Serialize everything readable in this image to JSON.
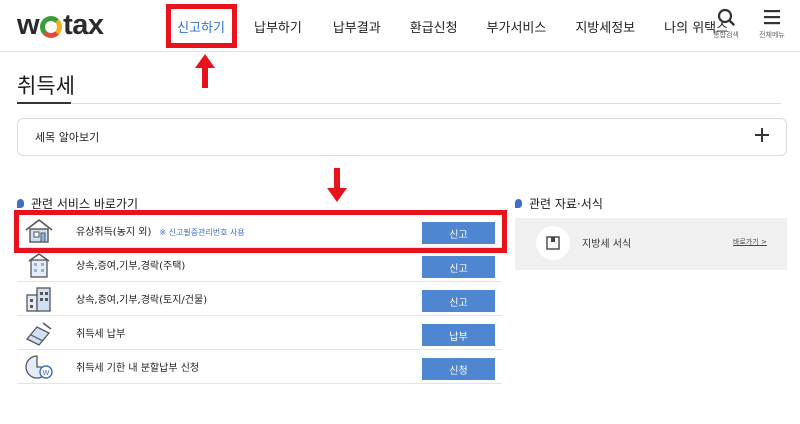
{
  "header": {
    "logo_before": "w",
    "logo_after": "tax",
    "nav": [
      "신고하기",
      "납부하기",
      "납부결과",
      "환급신청",
      "부가서비스",
      "지방세정보",
      "나의 위택스"
    ],
    "search_label": "통합검색",
    "menu_label": "전체메뉴"
  },
  "page": {
    "title": "취득세"
  },
  "accordion": {
    "label": "세목 알아보기"
  },
  "services": {
    "heading": "관련 서비스 바로가기",
    "items": [
      {
        "name": "유상취득(농지 외)",
        "note": "※ 신고필증관리번호 사용",
        "button": "신고",
        "icon": "house-icon"
      },
      {
        "name": "상속,증여,기부,경락(주택)",
        "note": "",
        "button": "신고",
        "icon": "apartment-icon"
      },
      {
        "name": "상속,증여,기부,경락(토지/건물)",
        "note": "",
        "button": "신고",
        "icon": "building-icon"
      },
      {
        "name": "취득세 납부",
        "note": "",
        "button": "납부",
        "icon": "card-payment-icon"
      },
      {
        "name": "취득세 기한 내 분할납부 신청",
        "note": "",
        "button": "신청",
        "icon": "pie-won-icon"
      }
    ]
  },
  "forms": {
    "heading": "관련 자료·서식",
    "item_label": "지방세 서식",
    "item_link": "바로가기 >"
  },
  "colors": {
    "accent": "#4f86d1",
    "highlight": "#e8121c",
    "active_nav": "#2f6fd0"
  }
}
